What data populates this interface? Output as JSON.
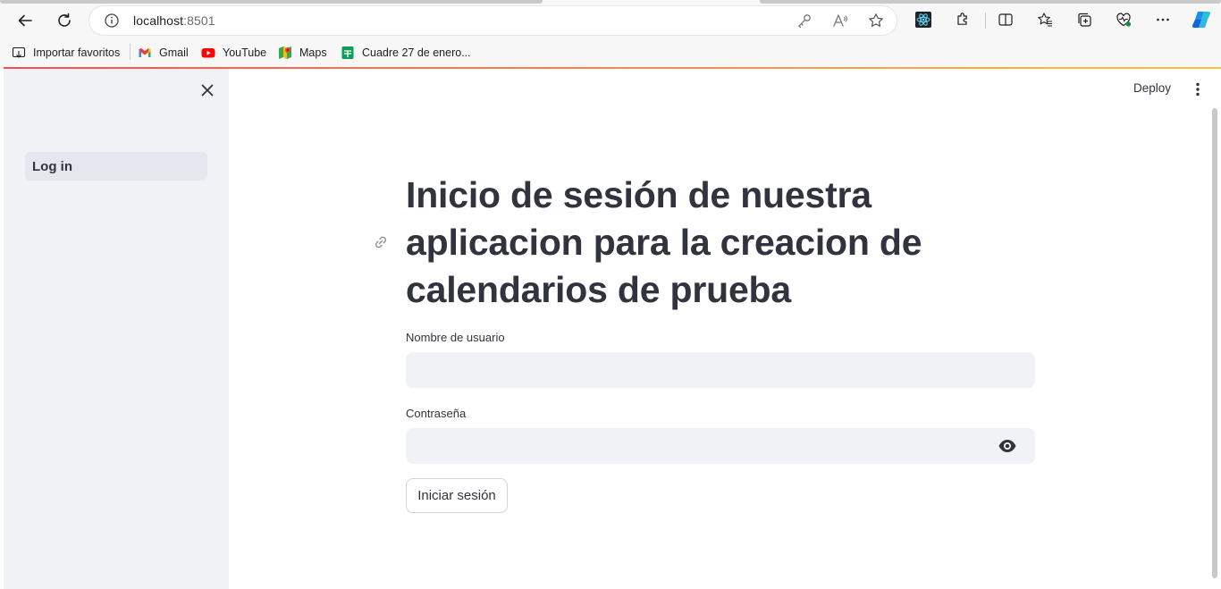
{
  "browser": {
    "url_host": "localhost",
    "url_port": ":8501",
    "bookmarks": [
      {
        "label": "Importar favoritos",
        "icon": "import-favorites-icon"
      },
      {
        "label": "Gmail",
        "icon": "gmail-icon"
      },
      {
        "label": "YouTube",
        "icon": "youtube-icon"
      },
      {
        "label": "Maps",
        "icon": "maps-icon"
      },
      {
        "label": "Cuadre 27 de enero...",
        "icon": "sheets-icon"
      }
    ]
  },
  "sidebar": {
    "items": [
      {
        "label": "Log in",
        "active": true
      }
    ]
  },
  "header": {
    "deploy_label": "Deploy"
  },
  "main": {
    "title": "Inicio de sesión de nuestra aplicacion para la creacion de calendarios de prueba",
    "username_label": "Nombre de usuario",
    "username_value": "",
    "password_label": "Contraseña",
    "password_value": "",
    "submit_label": "Iniciar sesión"
  },
  "colors": {
    "accent_gradient_start": "#ff4b4b",
    "accent_gradient_end": "#ffbd45",
    "sidebar_bg": "#f0f2f6",
    "text": "#31333f"
  }
}
